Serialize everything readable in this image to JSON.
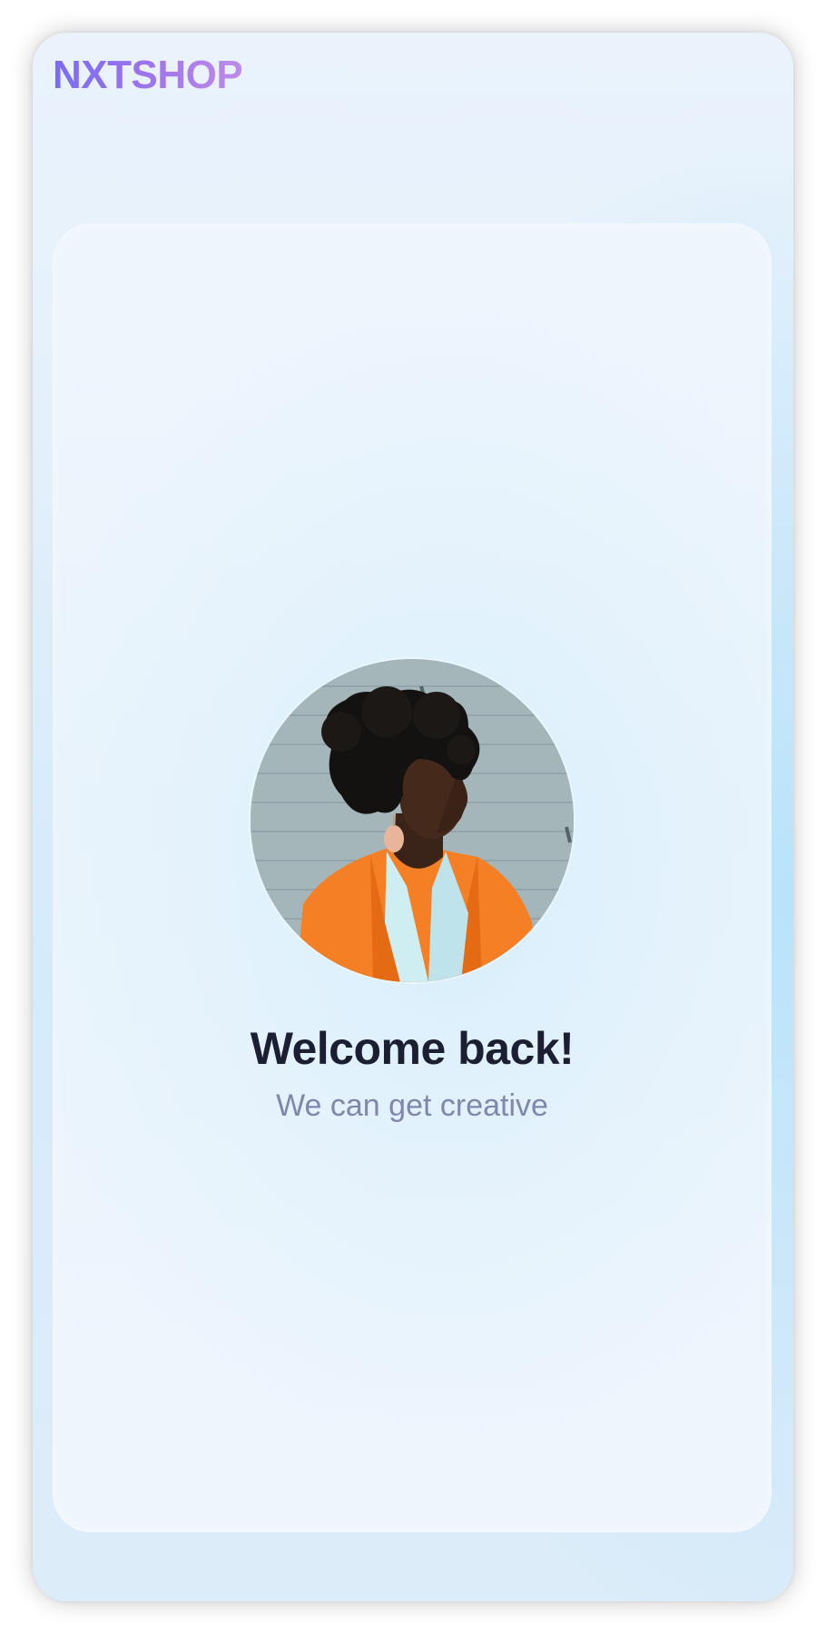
{
  "app": {
    "logo_text": "NXTSHOP"
  },
  "welcome": {
    "title": "Welcome back!",
    "subtitle": "We can get creative",
    "avatar_description": "profile-photo"
  },
  "colors": {
    "brand_gradient_start": "#7a6cf4",
    "brand_gradient_end": "#c08ae8",
    "title_color": "#1c1f33",
    "subtitle_color": "#8186ac",
    "background": "#e1eff9"
  }
}
